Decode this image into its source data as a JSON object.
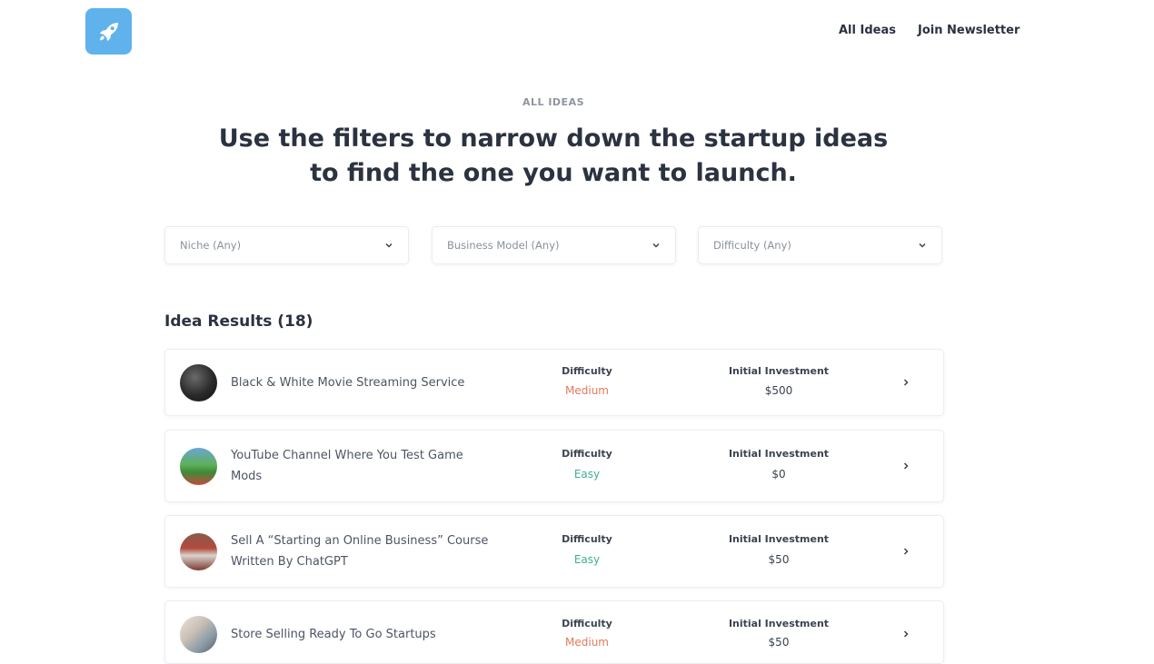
{
  "header": {
    "nav": [
      {
        "label": "All Ideas"
      },
      {
        "label": "Join Newsletter"
      }
    ]
  },
  "hero": {
    "eyebrow": "ALL IDEAS",
    "headline_line1": "Use the filters to narrow down the startup ideas",
    "headline_line2": "to find the one you want to launch."
  },
  "filters": [
    {
      "label": "Niche (Any)"
    },
    {
      "label": "Business Model (Any)"
    },
    {
      "label": "Difficulty (Any)"
    }
  ],
  "results": {
    "title": "Idea Results (18)",
    "difficulty_label": "Difficulty",
    "investment_label": "Initial Investment",
    "items": [
      {
        "title": "Black & White Movie Streaming Service",
        "difficulty": "Medium",
        "investment": "$500"
      },
      {
        "title": "YouTube Channel Where You Test Game Mods",
        "difficulty": "Easy",
        "investment": "$0"
      },
      {
        "title": "Sell A “Starting an Online Business” Course Written By ChatGPT",
        "difficulty": "Easy",
        "investment": "$50"
      },
      {
        "title": "Store Selling Ready To Go Startups",
        "difficulty": "Medium",
        "investment": "$50"
      }
    ]
  },
  "colors": {
    "accent": "#5fb2ec",
    "medium": "#e07b5a",
    "easy": "#3fb08f"
  }
}
